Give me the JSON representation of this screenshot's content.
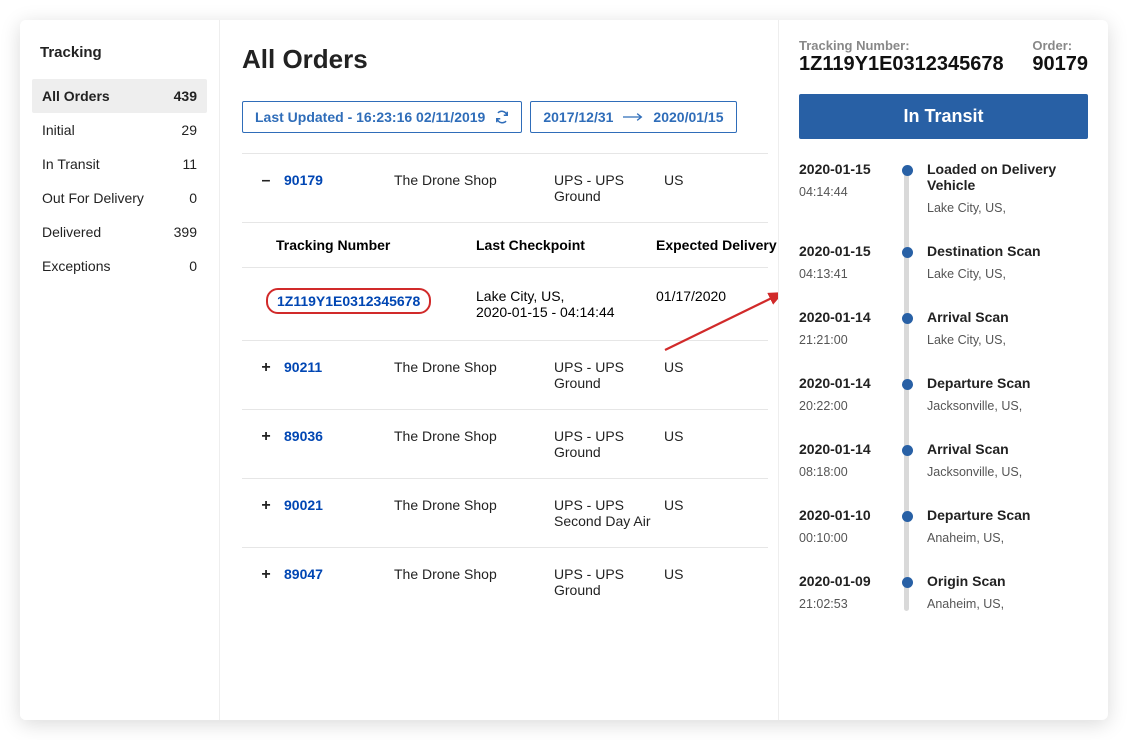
{
  "sidebar": {
    "title": "Tracking",
    "items": [
      {
        "label": "All Orders",
        "count": "439"
      },
      {
        "label": "Initial",
        "count": "29"
      },
      {
        "label": "In Transit",
        "count": "11"
      },
      {
        "label": "Out For Delivery",
        "count": "0"
      },
      {
        "label": "Delivered",
        "count": "399"
      },
      {
        "label": "Exceptions",
        "count": "0"
      }
    ]
  },
  "main": {
    "title": "All Orders",
    "last_updated": "Last Updated - 16:23:16 02/11/2019",
    "date_from": "2017/12/31",
    "date_to": "2020/01/15",
    "cols": {
      "tracking": "Tracking Number",
      "last_checkpoint": "Last Checkpoint",
      "expected": "Expected Delivery"
    },
    "expanded": {
      "order": "90179",
      "shop": "The Drone Shop",
      "service": "UPS - UPS Ground",
      "country": "US",
      "tracking_number": "1Z119Y1E0312345678",
      "checkpoint_line1": "Lake City, US,",
      "checkpoint_line2": "2020-01-15 - 04:14:44",
      "expected_delivery": "01/17/2020",
      "toggle": "–"
    },
    "rows": [
      {
        "toggle": "+",
        "order": "90211",
        "shop": "The Drone Shop",
        "service": "UPS - UPS Ground",
        "country": "US"
      },
      {
        "toggle": "+",
        "order": "89036",
        "shop": "The Drone Shop",
        "service": "UPS - UPS Ground",
        "country": "US"
      },
      {
        "toggle": "+",
        "order": "90021",
        "shop": "The Drone Shop",
        "service": "UPS - UPS Second Day Air",
        "country": "US"
      },
      {
        "toggle": "+",
        "order": "89047",
        "shop": "The Drone Shop",
        "service": "UPS - UPS Ground",
        "country": "US"
      }
    ]
  },
  "panel": {
    "tracking_label": "Tracking Number:",
    "tracking_value": "1Z119Y1E0312345678",
    "order_label": "Order:",
    "order_value": "90179",
    "status": "In Transit",
    "events": [
      {
        "date": "2020-01-15",
        "time": "04:14:44",
        "title": "Loaded on Delivery Vehicle",
        "loc": "Lake City, US,"
      },
      {
        "date": "2020-01-15",
        "time": "04:13:41",
        "title": "Destination Scan",
        "loc": "Lake City, US,"
      },
      {
        "date": "2020-01-14",
        "time": "21:21:00",
        "title": "Arrival Scan",
        "loc": "Lake City, US,"
      },
      {
        "date": "2020-01-14",
        "time": "20:22:00",
        "title": "Departure Scan",
        "loc": "Jacksonville, US,"
      },
      {
        "date": "2020-01-14",
        "time": "08:18:00",
        "title": "Arrival Scan",
        "loc": "Jacksonville, US,"
      },
      {
        "date": "2020-01-10",
        "time": "00:10:00",
        "title": "Departure Scan",
        "loc": "Anaheim, US,"
      },
      {
        "date": "2020-01-09",
        "time": "21:02:53",
        "title": "Origin Scan",
        "loc": "Anaheim, US,"
      }
    ]
  }
}
